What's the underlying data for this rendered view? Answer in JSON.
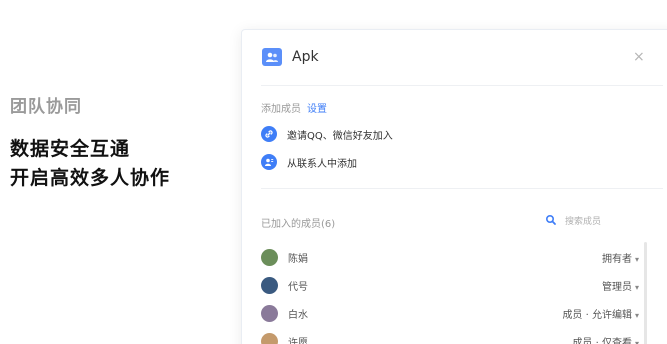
{
  "promo": {
    "subtitle": "团队协同",
    "headline_1": "数据安全互通",
    "headline_2": "开启高效多人协作"
  },
  "dialog": {
    "title": "Apk",
    "close_glyph": "×",
    "add_members_label": "添加成员",
    "settings_link": "设置",
    "actions": [
      {
        "label": "邀请QQ、微信好友加入",
        "icon": "link-icon"
      },
      {
        "label": "从联系人中添加",
        "icon": "contacts-icon"
      }
    ],
    "members_header": "已加入的成员(6)",
    "search_placeholder": "搜索成员",
    "members": [
      {
        "name": "陈娟",
        "role": "拥有者",
        "avatar_color": "#6b8e5a"
      },
      {
        "name": "代号",
        "role": "管理员",
        "avatar_color": "#3a5a80"
      },
      {
        "name": "白水",
        "role": "成员 · 允许编辑",
        "avatar_color": "#8a7a9a"
      },
      {
        "name": "许愿",
        "role": "成员 · 仅查看",
        "avatar_color": "#c49a6c"
      }
    ]
  },
  "colors": {
    "accent": "#3f7ef7",
    "team_icon": "#5b8ff9",
    "muted_text": "#999999"
  }
}
